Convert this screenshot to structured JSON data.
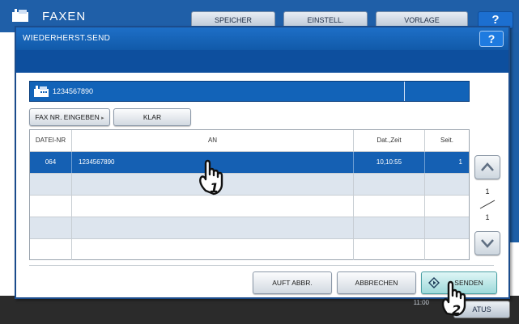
{
  "background": {
    "title": "FAXEN",
    "tabs": [
      "SPEICHER",
      "EINSTELL.",
      "VORLAGE"
    ],
    "help_label": "?",
    "time": "11:00",
    "status_label": "ATUS"
  },
  "dialog": {
    "title": "WIEDERHERST.SEND",
    "help_label": "?",
    "recipient": "1234567890",
    "buttons": {
      "fax_nr": "FAX NR. EINGEBEN",
      "klar": "KLAR",
      "auft_abbr": "AUFT ABBR.",
      "abbrechen": "ABBRECHEN",
      "senden": "SENDEN"
    },
    "table": {
      "headers": {
        "file": "DATEI-NR",
        "an": "AN",
        "date": "Dat.,Zeit",
        "pages": "Seit."
      },
      "rows": [
        {
          "file": "064",
          "an": "1234567890",
          "date": "10,10:55",
          "pages": "1"
        }
      ]
    },
    "pagination": {
      "current": "1",
      "total": "1"
    }
  },
  "callouts": [
    "1",
    "2"
  ],
  "colors": {
    "accent": "#1560b3",
    "header": "#115aa9",
    "send": "#9ed9da"
  }
}
